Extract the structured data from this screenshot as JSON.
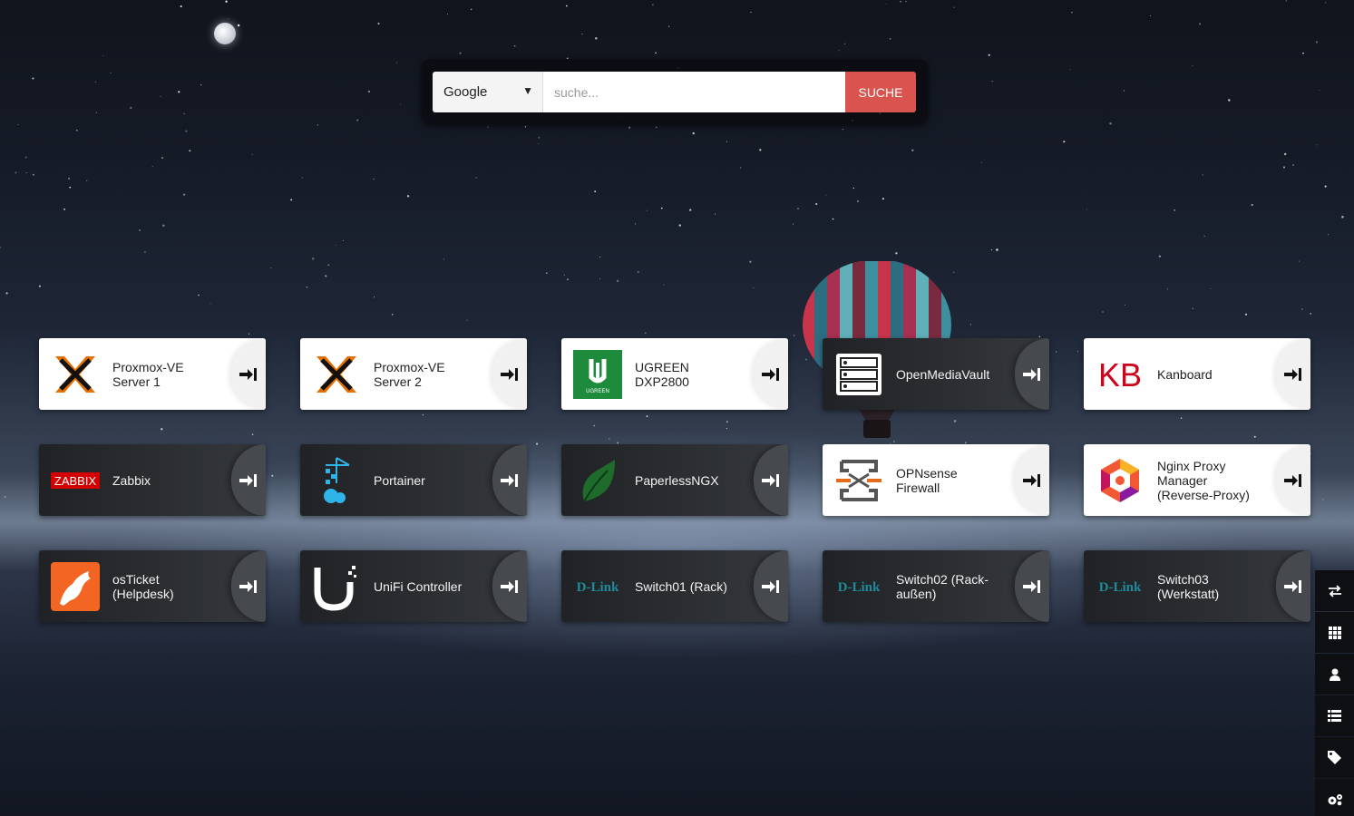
{
  "search": {
    "engine": "Google",
    "placeholder": "suche...",
    "button_label": "SUCHE"
  },
  "tiles": [
    {
      "label": "Proxmox-VE\nServer 1",
      "theme": "light",
      "icon": "proxmox-icon"
    },
    {
      "label": "Proxmox-VE\nServer 2",
      "theme": "light",
      "icon": "proxmox-icon"
    },
    {
      "label": "UGREEN\nDXP2800",
      "theme": "light",
      "icon": "ugreen-icon",
      "icon_text": "UGREEN"
    },
    {
      "label": "OpenMediaVault",
      "theme": "dark",
      "icon": "openmediavault-icon"
    },
    {
      "label": "Kanboard",
      "theme": "light",
      "icon": "kanboard-icon",
      "icon_text": "KB"
    },
    {
      "label": "Zabbix",
      "theme": "dark",
      "icon": "zabbix-icon",
      "icon_text": "ZABBIX"
    },
    {
      "label": "Portainer",
      "theme": "dark",
      "icon": "portainer-icon"
    },
    {
      "label": "PaperlessNGX",
      "theme": "dark",
      "icon": "paperless-icon"
    },
    {
      "label": "OPNsense\nFirewall",
      "theme": "light",
      "icon": "opnsense-icon"
    },
    {
      "label": "Nginx Proxy\nManager\n(Reverse-Proxy)",
      "theme": "light",
      "icon": "nginx-proxy-manager-icon"
    },
    {
      "label": "osTicket\n(Helpdesk)",
      "theme": "dark",
      "icon": "osticket-icon"
    },
    {
      "label": "UniFi Controller",
      "theme": "dark",
      "icon": "unifi-icon"
    },
    {
      "label": "Switch01 (Rack)",
      "theme": "dark",
      "icon": "dlink-icon",
      "icon_text": "D-Link"
    },
    {
      "label": "Switch02 (Rack-\naußen)",
      "theme": "dark",
      "icon": "dlink-icon",
      "icon_text": "D-Link"
    },
    {
      "label": "Switch03\n(Werkstatt)",
      "theme": "dark",
      "icon": "dlink-icon",
      "icon_text": "D-Link"
    }
  ],
  "sidebar": [
    {
      "icon": "swap-arrows-icon"
    },
    {
      "icon": "grid-icon"
    },
    {
      "icon": "user-icon"
    },
    {
      "icon": "list-icon"
    },
    {
      "icon": "tag-icon"
    },
    {
      "icon": "gears-icon"
    }
  ],
  "colors": {
    "search_button": "#d9534f",
    "proxmox_orange": "#e57000",
    "ugreen_green": "#1e8a3c",
    "kanboard_red": "#d0021b",
    "zabbix_red": "#d40000",
    "dlink_teal": "#1f8a9a"
  }
}
